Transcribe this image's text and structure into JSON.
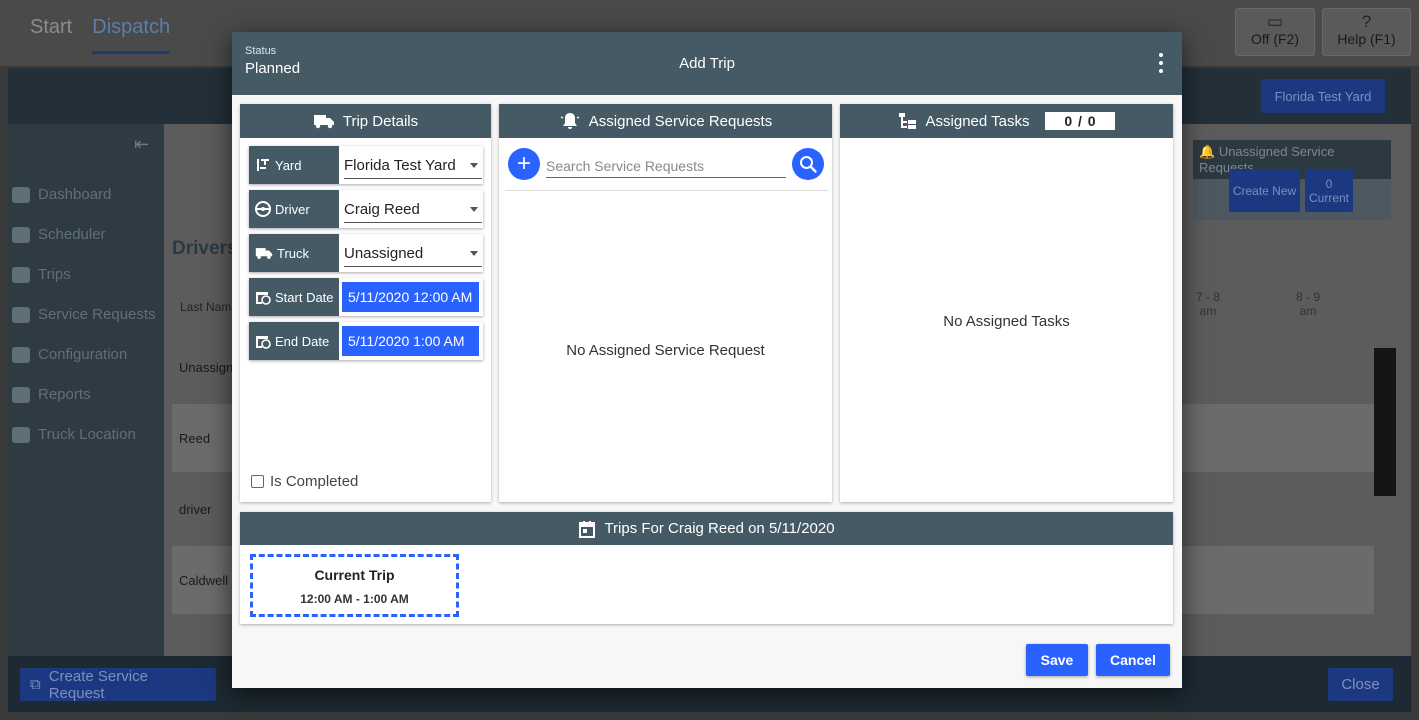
{
  "background": {
    "nav": [
      "Start",
      "Dispatch"
    ],
    "top_buttons": [
      {
        "icon": "monitor-off-icon",
        "label": "Off (F2)"
      },
      {
        "icon": "question-icon",
        "label": "Help (F1)"
      }
    ],
    "yard_button": "Florida Test Yard",
    "sidebar": [
      "Dashboard",
      "Scheduler",
      "Trips",
      "Service Requests",
      "Configuration",
      "Reports",
      "Truck Location"
    ],
    "drivers_heading": "Drivers",
    "last_name_header": "Last Name",
    "unassigned_panel": {
      "title": "Unassigned Service Requests",
      "create_new": "Create New",
      "current_count": "0",
      "current_label": "Current"
    },
    "hours": [
      {
        "range": "7 - 8",
        "period": "am"
      },
      {
        "range": "8 - 9",
        "period": "am"
      }
    ],
    "rows": [
      "Unassign",
      "Reed",
      "driver",
      "Caldwell"
    ],
    "bottom": {
      "create_service_request": "Create Service Request",
      "close": "Close"
    }
  },
  "modal": {
    "status_label": "Status",
    "status_value": "Planned",
    "title": "Add Trip",
    "trip_details": {
      "title": "Trip Details",
      "yard_label": "Yard",
      "yard_value": "Florida Test Yard",
      "driver_label": "Driver",
      "driver_value": "Craig Reed",
      "truck_label": "Truck",
      "truck_value": "Unassigned",
      "start_label": "Start Date",
      "start_value": "5/11/2020 12:00 AM",
      "end_label": "End Date",
      "end_value": "5/11/2020 1:00 AM",
      "is_completed_label": "Is Completed",
      "is_completed": false
    },
    "service_requests": {
      "title": "Assigned Service Requests",
      "search_placeholder": "Search Service Requests",
      "empty": "No Assigned Service Request"
    },
    "tasks": {
      "title": "Assigned Tasks",
      "count": "0 / 0",
      "empty": "No Assigned Tasks"
    },
    "trips_for": {
      "title": "Trips For Craig Reed on 5/11/2020",
      "card_title": "Current Trip",
      "card_time": "12:00 AM - 1:00 AM"
    },
    "save_label": "Save",
    "cancel_label": "Cancel"
  },
  "colors": {
    "accent": "#2962ff",
    "header": "#455a64"
  }
}
